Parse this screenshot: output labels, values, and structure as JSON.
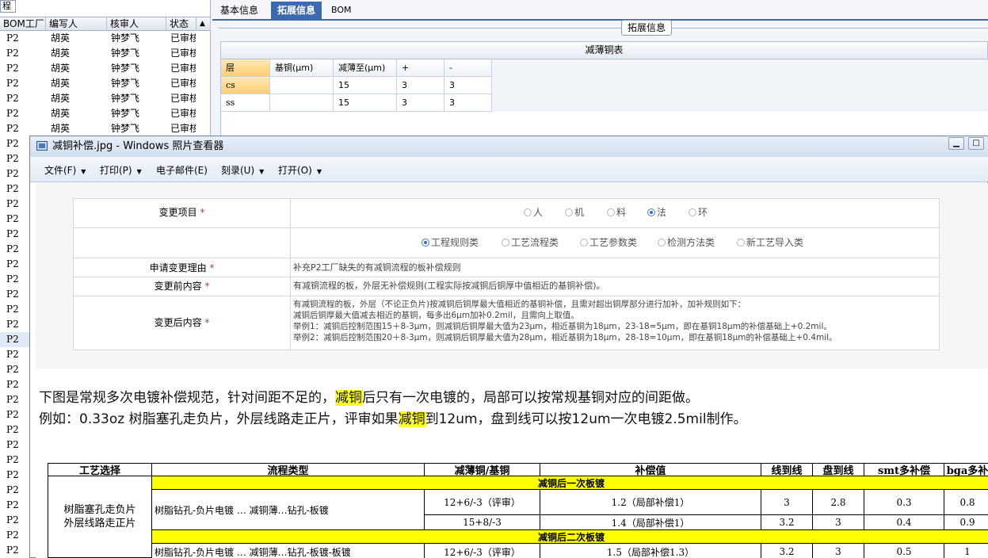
{
  "left": {
    "title": "程",
    "headers": [
      "BOM工厂",
      "编写人",
      "核审人",
      "状态"
    ],
    "rows": [
      {
        "factory": "P2",
        "writer": "胡英",
        "reviewer": "钟梦飞",
        "status": "已审核"
      },
      {
        "factory": "P2",
        "writer": "胡英",
        "reviewer": "钟梦飞",
        "status": "已审核"
      },
      {
        "factory": "P2",
        "writer": "胡英",
        "reviewer": "钟梦飞",
        "status": "已审核"
      },
      {
        "factory": "P2",
        "writer": "胡英",
        "reviewer": "钟梦飞",
        "status": "已审核"
      },
      {
        "factory": "P2",
        "writer": "胡英",
        "reviewer": "钟梦飞",
        "status": "已审核"
      },
      {
        "factory": "P2",
        "writer": "胡英",
        "reviewer": "钟梦飞",
        "status": "已审核"
      },
      {
        "factory": "P2",
        "writer": "胡英",
        "reviewer": "钟梦飞",
        "status": "已审核"
      }
    ],
    "more_factory": "P2"
  },
  "tabs": [
    "基本信息",
    "拓展信息",
    "BOM"
  ],
  "ext": {
    "legend": "拓展信息",
    "table_title": "减薄铜表",
    "headers": [
      "层",
      "基铜(μm)",
      "减薄至(μm)",
      "+",
      "-"
    ],
    "rows": [
      [
        "cs",
        "",
        "15",
        "3",
        "3"
      ],
      [
        "ss",
        "",
        "15",
        "3",
        "3"
      ]
    ]
  },
  "viewer": {
    "title": "减铜补偿.jpg - Windows 照片查看器",
    "menu": [
      "文件(F)",
      "打印(P)",
      "电子邮件(E)",
      "刻录(U)",
      "打开(O)"
    ]
  },
  "form": {
    "change_item_label": "变更项目",
    "star": "*",
    "change_item_options": [
      "人",
      "机",
      "料",
      "法",
      "环"
    ],
    "change_item_selected": "法",
    "category_options": [
      "工程规则类",
      "工艺流程类",
      "工艺参数类",
      "检测方法类",
      "新工艺导入类"
    ],
    "category_selected": "工程规则类",
    "reason_label": "申请变更理由",
    "reason_value": "补充P2工厂缺失的有减铜流程的板补偿规则",
    "before_label": "变更前内容",
    "before_value": "有减铜流程的板，外层无补偿规则(工程实际按减铜后铜厚中值相近的基铜补偿)。",
    "after_label": "变更后内容",
    "after_lines": [
      "有减铜流程的板，外层（不论正负片)按减铜后铜厚最大值相近的基铜补偿，且需对超出铜厚部分进行加补，加补规则如下：",
      "减铜后铜厚最大值减去相近的基铜，每多出6μm加补0.2mil，且需向上取值。",
      "举例1：减铜后控制范围15＋8-3μm，则减铜后铜厚最大值为23μm，相近基铜为18μm，23-18=5μm，即在基铜18μm的补偿基础上+0.2mil。",
      "举例2：减铜后控制范围20＋8-3μm，则减铜后铜厚最大值为28μm，相近基铜为18μm，28-18=10μm，即在基铜18μm的补偿基础上+0.4mil。"
    ]
  },
  "notes": {
    "line1_a": "下图是常规多次电镀补偿规范，针对间距不足的，",
    "line1_mark": "减铜",
    "line1_b": "后只有一次电镀的，局部可以按常规基铜对应的间距做。",
    "line2_a": "例如：0.33oz 树脂塞孔走负片，外层线路走正片，评审如果",
    "line2_mark": "减铜",
    "line2_b": "到12um，盘到线可以按12um一次电镀2.5mil制作。"
  },
  "spec_table": {
    "headers": [
      "工艺选择",
      "流程类型",
      "减薄铜/基铜",
      "补偿值",
      "线到线",
      "盘到线",
      "smt多补偿",
      "bga多补"
    ],
    "section1": "减铜后一次板镀",
    "section2": "减铜后二次板镀",
    "process_choice": "树脂塞孔走负片\n外层线路走正片",
    "flow1": "树脂钻孔-负片电镀 … 减铜薄…钻孔-板镀",
    "flow2": "树脂钻孔-负片电镀 … 减铜薄…钻孔-板镀-板镀",
    "rows1": [
      [
        "12+6/-3（评审）",
        "1.2（局部补偿1）",
        "3",
        "2.8",
        "0.3",
        "0.8"
      ],
      [
        "15+8/-3",
        "1.4（局部补偿1）",
        "3.2",
        "3",
        "0.4",
        "0.9"
      ]
    ],
    "rows2": [
      [
        "12+6/-3（评审）",
        "1.5（局部补偿1.3）",
        "3.2",
        "3",
        "0.5",
        "1"
      ]
    ]
  }
}
